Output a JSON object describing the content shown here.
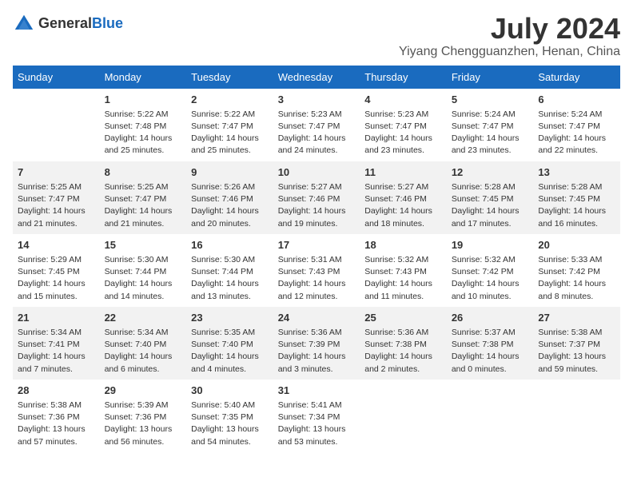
{
  "header": {
    "logo_general": "General",
    "logo_blue": "Blue",
    "month_title": "July 2024",
    "location": "Yiyang Chengguanzhen, Henan, China"
  },
  "days_of_week": [
    "Sunday",
    "Monday",
    "Tuesday",
    "Wednesday",
    "Thursday",
    "Friday",
    "Saturday"
  ],
  "weeks": [
    [
      {
        "num": "",
        "info": ""
      },
      {
        "num": "1",
        "info": "Sunrise: 5:22 AM\nSunset: 7:48 PM\nDaylight: 14 hours\nand 25 minutes."
      },
      {
        "num": "2",
        "info": "Sunrise: 5:22 AM\nSunset: 7:47 PM\nDaylight: 14 hours\nand 25 minutes."
      },
      {
        "num": "3",
        "info": "Sunrise: 5:23 AM\nSunset: 7:47 PM\nDaylight: 14 hours\nand 24 minutes."
      },
      {
        "num": "4",
        "info": "Sunrise: 5:23 AM\nSunset: 7:47 PM\nDaylight: 14 hours\nand 23 minutes."
      },
      {
        "num": "5",
        "info": "Sunrise: 5:24 AM\nSunset: 7:47 PM\nDaylight: 14 hours\nand 23 minutes."
      },
      {
        "num": "6",
        "info": "Sunrise: 5:24 AM\nSunset: 7:47 PM\nDaylight: 14 hours\nand 22 minutes."
      }
    ],
    [
      {
        "num": "7",
        "info": "Sunrise: 5:25 AM\nSunset: 7:47 PM\nDaylight: 14 hours\nand 21 minutes."
      },
      {
        "num": "8",
        "info": "Sunrise: 5:25 AM\nSunset: 7:47 PM\nDaylight: 14 hours\nand 21 minutes."
      },
      {
        "num": "9",
        "info": "Sunrise: 5:26 AM\nSunset: 7:46 PM\nDaylight: 14 hours\nand 20 minutes."
      },
      {
        "num": "10",
        "info": "Sunrise: 5:27 AM\nSunset: 7:46 PM\nDaylight: 14 hours\nand 19 minutes."
      },
      {
        "num": "11",
        "info": "Sunrise: 5:27 AM\nSunset: 7:46 PM\nDaylight: 14 hours\nand 18 minutes."
      },
      {
        "num": "12",
        "info": "Sunrise: 5:28 AM\nSunset: 7:45 PM\nDaylight: 14 hours\nand 17 minutes."
      },
      {
        "num": "13",
        "info": "Sunrise: 5:28 AM\nSunset: 7:45 PM\nDaylight: 14 hours\nand 16 minutes."
      }
    ],
    [
      {
        "num": "14",
        "info": "Sunrise: 5:29 AM\nSunset: 7:45 PM\nDaylight: 14 hours\nand 15 minutes."
      },
      {
        "num": "15",
        "info": "Sunrise: 5:30 AM\nSunset: 7:44 PM\nDaylight: 14 hours\nand 14 minutes."
      },
      {
        "num": "16",
        "info": "Sunrise: 5:30 AM\nSunset: 7:44 PM\nDaylight: 14 hours\nand 13 minutes."
      },
      {
        "num": "17",
        "info": "Sunrise: 5:31 AM\nSunset: 7:43 PM\nDaylight: 14 hours\nand 12 minutes."
      },
      {
        "num": "18",
        "info": "Sunrise: 5:32 AM\nSunset: 7:43 PM\nDaylight: 14 hours\nand 11 minutes."
      },
      {
        "num": "19",
        "info": "Sunrise: 5:32 AM\nSunset: 7:42 PM\nDaylight: 14 hours\nand 10 minutes."
      },
      {
        "num": "20",
        "info": "Sunrise: 5:33 AM\nSunset: 7:42 PM\nDaylight: 14 hours\nand 8 minutes."
      }
    ],
    [
      {
        "num": "21",
        "info": "Sunrise: 5:34 AM\nSunset: 7:41 PM\nDaylight: 14 hours\nand 7 minutes."
      },
      {
        "num": "22",
        "info": "Sunrise: 5:34 AM\nSunset: 7:40 PM\nDaylight: 14 hours\nand 6 minutes."
      },
      {
        "num": "23",
        "info": "Sunrise: 5:35 AM\nSunset: 7:40 PM\nDaylight: 14 hours\nand 4 minutes."
      },
      {
        "num": "24",
        "info": "Sunrise: 5:36 AM\nSunset: 7:39 PM\nDaylight: 14 hours\nand 3 minutes."
      },
      {
        "num": "25",
        "info": "Sunrise: 5:36 AM\nSunset: 7:38 PM\nDaylight: 14 hours\nand 2 minutes."
      },
      {
        "num": "26",
        "info": "Sunrise: 5:37 AM\nSunset: 7:38 PM\nDaylight: 14 hours\nand 0 minutes."
      },
      {
        "num": "27",
        "info": "Sunrise: 5:38 AM\nSunset: 7:37 PM\nDaylight: 13 hours\nand 59 minutes."
      }
    ],
    [
      {
        "num": "28",
        "info": "Sunrise: 5:38 AM\nSunset: 7:36 PM\nDaylight: 13 hours\nand 57 minutes."
      },
      {
        "num": "29",
        "info": "Sunrise: 5:39 AM\nSunset: 7:36 PM\nDaylight: 13 hours\nand 56 minutes."
      },
      {
        "num": "30",
        "info": "Sunrise: 5:40 AM\nSunset: 7:35 PM\nDaylight: 13 hours\nand 54 minutes."
      },
      {
        "num": "31",
        "info": "Sunrise: 5:41 AM\nSunset: 7:34 PM\nDaylight: 13 hours\nand 53 minutes."
      },
      {
        "num": "",
        "info": ""
      },
      {
        "num": "",
        "info": ""
      },
      {
        "num": "",
        "info": ""
      }
    ]
  ]
}
